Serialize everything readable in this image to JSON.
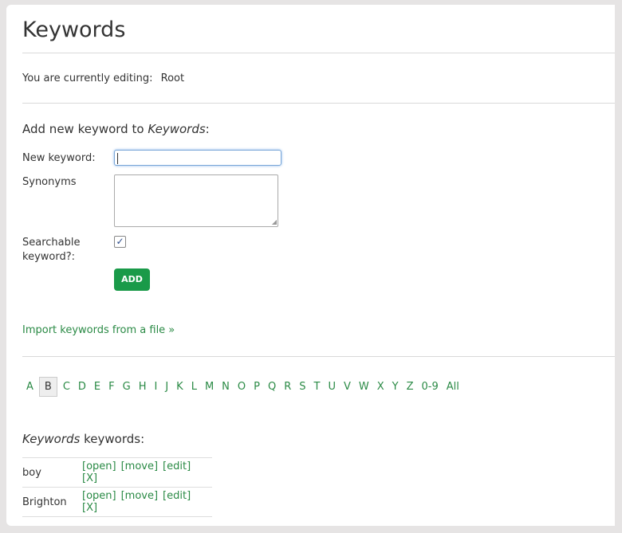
{
  "page": {
    "title": "Keywords",
    "editing_text": "You are currently editing:",
    "editing_value": "Root"
  },
  "form": {
    "heading_prefix": "Add new keyword to ",
    "heading_em": "Keywords",
    "heading_suffix": ":",
    "new_keyword_label": "New keyword:",
    "new_keyword_value": "",
    "synonyms_label": "Synonyms",
    "searchable_label_line1": "Searchable",
    "searchable_label_line2": "keyword?:",
    "searchable_checked": true,
    "add_label": "ADD",
    "add_color": "#1a9a49",
    "import_link": "Import keywords from a file »"
  },
  "alphabet": {
    "letters": [
      "A",
      "B",
      "C",
      "D",
      "E",
      "F",
      "G",
      "H",
      "I",
      "J",
      "K",
      "L",
      "M",
      "N",
      "O",
      "P",
      "Q",
      "R",
      "S",
      "T",
      "U",
      "V",
      "W",
      "X",
      "Y",
      "Z",
      "0-9",
      "All"
    ],
    "selected": "B"
  },
  "list": {
    "heading_em": "Keywords",
    "heading_suffix": " keywords:",
    "actions": [
      "[open]",
      "[move]",
      "[edit]",
      "[X]"
    ],
    "rows": [
      {
        "name": "boy"
      },
      {
        "name": "Brighton"
      }
    ]
  },
  "colors": {
    "link": "#2a8a45",
    "background": "#e6e4e4"
  }
}
